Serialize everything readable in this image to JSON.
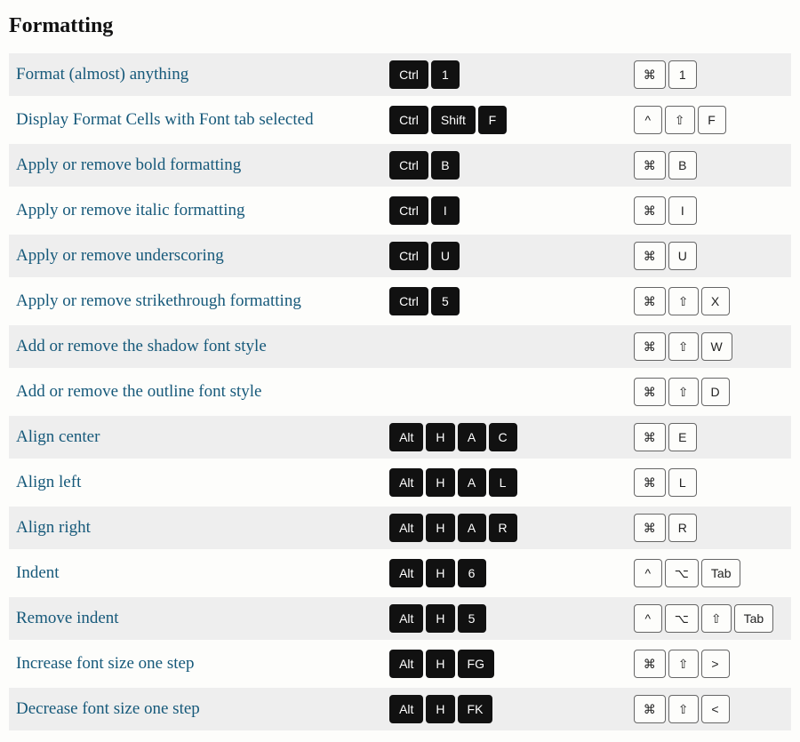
{
  "section": {
    "title": "Formatting"
  },
  "shortcuts": [
    {
      "desc": "Format (almost) anything",
      "win": [
        "Ctrl",
        "1"
      ],
      "mac": [
        "⌘",
        "1"
      ]
    },
    {
      "desc": "Display Format Cells with Font tab selected",
      "win": [
        "Ctrl",
        "Shift",
        "F"
      ],
      "mac": [
        "^",
        "⇧",
        "F"
      ]
    },
    {
      "desc": "Apply or remove bold formatting",
      "win": [
        "Ctrl",
        "B"
      ],
      "mac": [
        "⌘",
        "B"
      ]
    },
    {
      "desc": "Apply or remove italic formatting",
      "win": [
        "Ctrl",
        "I"
      ],
      "mac": [
        "⌘",
        "I"
      ]
    },
    {
      "desc": "Apply or remove underscoring",
      "win": [
        "Ctrl",
        "U"
      ],
      "mac": [
        "⌘",
        "U"
      ]
    },
    {
      "desc": "Apply or remove strikethrough formatting",
      "win": [
        "Ctrl",
        "5"
      ],
      "mac": [
        "⌘",
        "⇧",
        "X"
      ]
    },
    {
      "desc": "Add or remove the shadow font style",
      "win": [],
      "mac": [
        "⌘",
        "⇧",
        "W"
      ]
    },
    {
      "desc": "Add or remove the outline font style",
      "win": [],
      "mac": [
        "⌘",
        "⇧",
        "D"
      ]
    },
    {
      "desc": "Align center",
      "win": [
        "Alt",
        "H",
        "A",
        "C"
      ],
      "mac": [
        "⌘",
        "E"
      ]
    },
    {
      "desc": "Align left",
      "win": [
        "Alt",
        "H",
        "A",
        "L"
      ],
      "mac": [
        "⌘",
        "L"
      ]
    },
    {
      "desc": "Align right",
      "win": [
        "Alt",
        "H",
        "A",
        "R"
      ],
      "mac": [
        "⌘",
        "R"
      ]
    },
    {
      "desc": "Indent",
      "win": [
        "Alt",
        "H",
        "6"
      ],
      "mac": [
        "^",
        "⌥",
        "Tab"
      ]
    },
    {
      "desc": "Remove indent",
      "win": [
        "Alt",
        "H",
        "5"
      ],
      "mac": [
        "^",
        "⌥",
        "⇧",
        "Tab"
      ]
    },
    {
      "desc": "Increase font size one step",
      "win": [
        "Alt",
        "H",
        "FG"
      ],
      "mac": [
        "⌘",
        "⇧",
        ">"
      ]
    },
    {
      "desc": "Decrease font size one step",
      "win": [
        "Alt",
        "H",
        "FK"
      ],
      "mac": [
        "⌘",
        "⇧",
        "<"
      ]
    }
  ]
}
